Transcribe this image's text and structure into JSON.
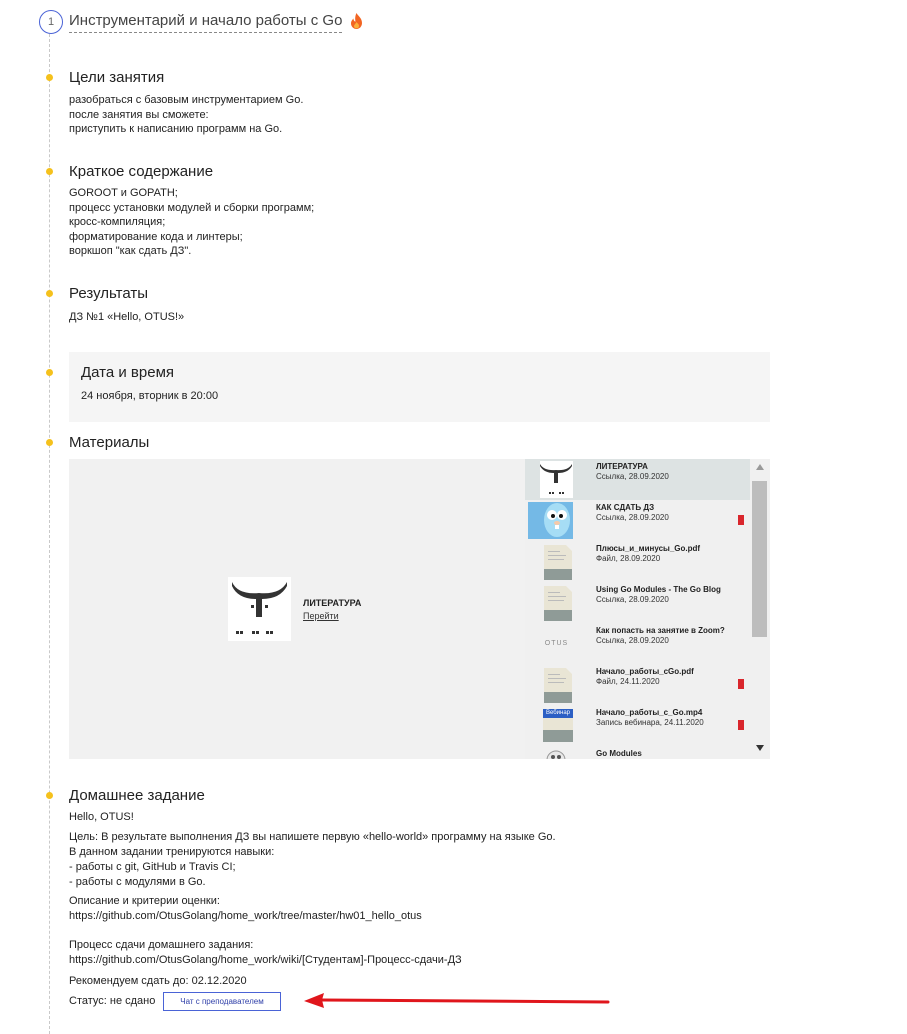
{
  "lesson": {
    "number": "1",
    "title": "Инструментарий и начало работы с Go"
  },
  "goals": {
    "title": "Цели занятия",
    "lines": [
      "разобраться с базовым инструментарием Go.",
      "после занятия вы сможете:",
      "приступить к написанию программ на Go."
    ]
  },
  "summary": {
    "title": "Краткое содержание",
    "lines": [
      "GOROOT и GOPATH;",
      "процесс установки модулей и сборки программ;",
      "кросс-компиляция;",
      "форматирование кода и линтеры;",
      "воркшоп \"как сдать ДЗ\"."
    ]
  },
  "results": {
    "title": "Результаты",
    "lines": [
      "ДЗ №1 «Hello, OTUS!»"
    ]
  },
  "datetime": {
    "title": "Дата и время",
    "value": "24 ноября, вторник в 20:00"
  },
  "materials": {
    "title": "Материалы",
    "preview": {
      "title": "ЛИТЕРАТУРА",
      "link": "Перейти"
    },
    "items": [
      {
        "name": "ЛИТЕРАТУРА",
        "meta": "Ссылка, 28.09.2020",
        "thumb": "otus-logo"
      },
      {
        "name": "КАК СДАТЬ ДЗ",
        "meta": "Ссылка, 28.09.2020",
        "thumb": "gopher"
      },
      {
        "name": "Плюсы_и_минусы_Go.pdf",
        "meta": "Файл, 28.09.2020",
        "thumb": "file"
      },
      {
        "name": "Using Go Modules - The Go Blog",
        "meta": "Ссылка, 28.09.2020",
        "thumb": "file"
      },
      {
        "name": "Как попасть на занятие в Zoom?",
        "meta": "Ссылка, 28.09.2020",
        "thumb": "otus-text"
      },
      {
        "name": "Начало_работы_cGo.pdf",
        "meta": "Файл, 24.11.2020",
        "thumb": "file"
      },
      {
        "name": "Начало_работы_с_Go.mp4",
        "meta": "Запись вебинара, 24.11.2020",
        "thumb": "webinar"
      },
      {
        "name": "Go Modules",
        "meta": "",
        "thumb": "gopher-small"
      }
    ],
    "thumb_texts": {
      "otus": "OTUS",
      "webinar": "Вебинар"
    }
  },
  "homework": {
    "title": "Домашнее задание",
    "name": "Hello, OTUS!",
    "goal_lines": [
      "Цель: В результате выполнения ДЗ вы напишете первую «hello-world» программу на языке Go.",
      "В данном задании тренируются навыки:",
      "- работы с git, GitHub и Travis CI;",
      "- работы с модулями в Go."
    ],
    "criteria_lines": [
      "Описание и критерии оценки:",
      "https://github.com/OtusGolang/home_work/tree/master/hw01_hello_otus"
    ],
    "process_lines": [
      "Процесс сдачи домашнего задания:",
      "https://github.com/OtusGolang/home_work/wiki/[Студентам]-Процесс-сдачи-ДЗ"
    ],
    "deadline": "Рекомендуем сдать до: 02.12.2020",
    "status": "Статус: не сдано",
    "chat_button": "Чат с преподавателем"
  },
  "colors": {
    "accent_dot": "#f5c11c",
    "number_ring": "#4a63d6",
    "bookmark": "#d9262c",
    "arrow": "#e0161c",
    "active_item": "#dde3e3"
  }
}
